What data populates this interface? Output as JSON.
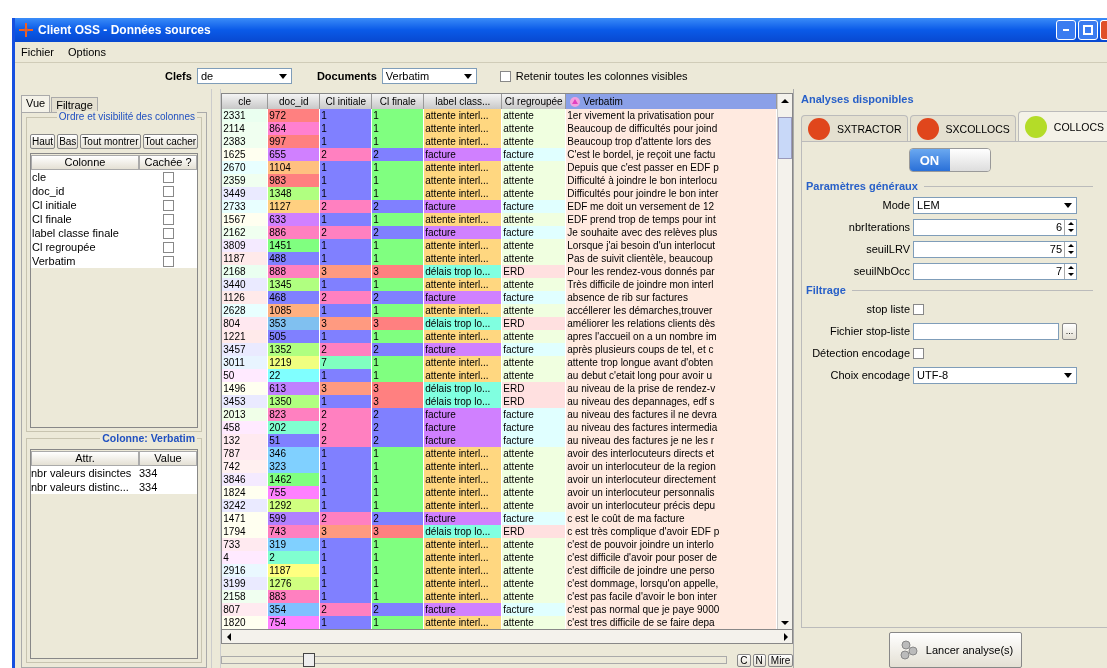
{
  "window": {
    "title": "Client OSS - Données sources"
  },
  "menu": [
    "Fichier",
    "Options"
  ],
  "toolbar": {
    "keys_label": "Clefs",
    "keys_value": "de",
    "documents_label": "Documents",
    "documents_value": "Verbatim",
    "retain": {
      "label": "Retenir toutes les colonnes visibles",
      "checked": false
    }
  },
  "left_tabs": [
    {
      "label": "Vue",
      "selected": true
    },
    {
      "label": "Filtrage",
      "selected": false
    }
  ],
  "columns_panel": {
    "title": "Ordre et visibilité des colonnes",
    "buttons": [
      "Haut",
      "Bas",
      "Tout montrer",
      "Tout cacher"
    ],
    "headers": [
      "Colonne",
      "Cachée ?"
    ],
    "rows": [
      {
        "name": "cle",
        "hidden": false
      },
      {
        "name": "doc_id",
        "hidden": false
      },
      {
        "name": "Cl initiale",
        "hidden": false
      },
      {
        "name": "Cl finale",
        "hidden": false
      },
      {
        "name": "label classe finale",
        "hidden": false
      },
      {
        "name": "Cl regroupée",
        "hidden": false
      },
      {
        "name": "Verbatim",
        "hidden": false
      }
    ]
  },
  "attr_panel": {
    "title": "Colonne: Verbatim",
    "headers": [
      "Attr.",
      "Value"
    ],
    "rows": [
      [
        "nbr valeurs disinctes",
        "334"
      ],
      [
        "nbr valeurs distinc...",
        "334"
      ]
    ]
  },
  "table": {
    "columns": [
      {
        "label": "cle",
        "selected": false
      },
      {
        "label": "doc_id",
        "selected": false
      },
      {
        "label": "Cl initiale",
        "selected": false
      },
      {
        "label": "Cl finale",
        "selected": false
      },
      {
        "label": "label class...",
        "selected": false
      },
      {
        "label": "Cl regroupée",
        "selected": false
      },
      {
        "label": "Verbatim",
        "selected": true
      }
    ],
    "rows": [
      {
        "cells": [
          {
            "text": "2331",
            "color": "#eafff0"
          },
          {
            "text": "972",
            "color": "#ff8080"
          },
          {
            "text": "1",
            "color": "#8080ff"
          },
          {
            "text": "1",
            "color": "#80ff80"
          },
          {
            "text": "attente interl...",
            "color": "#ffd780"
          },
          {
            "text": "attente",
            "color": "#f0ffe0"
          },
          {
            "text": "1er vivement la privatisation pour",
            "color": "#ffeae0"
          }
        ]
      },
      {
        "cells": [
          {
            "text": "2114",
            "color": "#f0fff0"
          },
          {
            "text": "864",
            "color": "#ff80d0"
          },
          {
            "text": "1",
            "color": "#8080ff"
          },
          {
            "text": "1",
            "color": "#80ff80"
          },
          {
            "text": "attente interl...",
            "color": "#ffd780"
          },
          {
            "text": "attente",
            "color": "#f0ffe0"
          },
          {
            "text": "Beaucoup de difficultés pour joind",
            "color": "#ffeae0"
          }
        ]
      },
      {
        "cells": [
          {
            "text": "2383",
            "color": "#f0fff0"
          },
          {
            "text": "997",
            "color": "#ff8080"
          },
          {
            "text": "1",
            "color": "#8080ff"
          },
          {
            "text": "1",
            "color": "#80ff80"
          },
          {
            "text": "attente interl...",
            "color": "#ffd780"
          },
          {
            "text": "attente",
            "color": "#f0ffe0"
          },
          {
            "text": "Beaucoup trop d'attente lors des",
            "color": "#ffeae0"
          }
        ]
      },
      {
        "cells": [
          {
            "text": "1625",
            "color": "#fffff0"
          },
          {
            "text": "655",
            "color": "#d080ff"
          },
          {
            "text": "2",
            "color": "#ff80c0"
          },
          {
            "text": "2",
            "color": "#8080ff"
          },
          {
            "text": "facture",
            "color": "#d080ff"
          },
          {
            "text": "facture",
            "color": "#e0ffff"
          },
          {
            "text": "C'est le bordel, je reçoit une factu",
            "color": "#ffeae0"
          }
        ]
      },
      {
        "cells": [
          {
            "text": "2670",
            "color": "#e8ffff"
          },
          {
            "text": "1104",
            "color": "#ffc080"
          },
          {
            "text": "1",
            "color": "#8080ff"
          },
          {
            "text": "1",
            "color": "#80ff80"
          },
          {
            "text": "attente interl...",
            "color": "#ffd780"
          },
          {
            "text": "attente",
            "color": "#f0ffe0"
          },
          {
            "text": "Depuis que c'est passer en EDF p",
            "color": "#ffeae0"
          }
        ]
      },
      {
        "cells": [
          {
            "text": "2359",
            "color": "#f0fff0"
          },
          {
            "text": "983",
            "color": "#ff8080"
          },
          {
            "text": "1",
            "color": "#8080ff"
          },
          {
            "text": "1",
            "color": "#80ff80"
          },
          {
            "text": "attente interl...",
            "color": "#ffd780"
          },
          {
            "text": "attente",
            "color": "#f0ffe0"
          },
          {
            "text": "Difficulté à joindre le bon interlocu",
            "color": "#ffeae0"
          }
        ]
      },
      {
        "cells": [
          {
            "text": "3449",
            "color": "#eaeaff"
          },
          {
            "text": "1348",
            "color": "#b0ff80"
          },
          {
            "text": "1",
            "color": "#8080ff"
          },
          {
            "text": "1",
            "color": "#80ff80"
          },
          {
            "text": "attente interl...",
            "color": "#ffd780"
          },
          {
            "text": "attente",
            "color": "#f0ffe0"
          },
          {
            "text": "Difficultés pour joindre le bon inter",
            "color": "#ffeae0"
          }
        ]
      },
      {
        "cells": [
          {
            "text": "2733",
            "color": "#e8ffff"
          },
          {
            "text": "1127",
            "color": "#ffd080"
          },
          {
            "text": "2",
            "color": "#ff80c0"
          },
          {
            "text": "2",
            "color": "#8080ff"
          },
          {
            "text": "facture",
            "color": "#d080ff"
          },
          {
            "text": "facture",
            "color": "#e0ffff"
          },
          {
            "text": "EDF me doit un versement de 12",
            "color": "#ffeae0"
          }
        ]
      },
      {
        "cells": [
          {
            "text": "1567",
            "color": "#fffff0"
          },
          {
            "text": "633",
            "color": "#d080ff"
          },
          {
            "text": "1",
            "color": "#8080ff"
          },
          {
            "text": "1",
            "color": "#80ff80"
          },
          {
            "text": "attente interl...",
            "color": "#ffd780"
          },
          {
            "text": "attente",
            "color": "#f0ffe0"
          },
          {
            "text": "EDF prend trop de temps pour int",
            "color": "#ffeae0"
          }
        ]
      },
      {
        "cells": [
          {
            "text": "2162",
            "color": "#f0fff0"
          },
          {
            "text": "886",
            "color": "#ff80c0"
          },
          {
            "text": "2",
            "color": "#ff80c0"
          },
          {
            "text": "2",
            "color": "#8080ff"
          },
          {
            "text": "facture",
            "color": "#d080ff"
          },
          {
            "text": "facture",
            "color": "#e0ffff"
          },
          {
            "text": "Je souhaite avec des relèves plus",
            "color": "#ffeae0"
          }
        ]
      },
      {
        "cells": [
          {
            "text": "3809",
            "color": "#f4eaff"
          },
          {
            "text": "1451",
            "color": "#80ff80"
          },
          {
            "text": "1",
            "color": "#8080ff"
          },
          {
            "text": "1",
            "color": "#80ff80"
          },
          {
            "text": "attente interl...",
            "color": "#ffd780"
          },
          {
            "text": "attente",
            "color": "#f0ffe0"
          },
          {
            "text": "Lorsque j'ai besoin d'un interlocut",
            "color": "#ffeae0"
          }
        ]
      },
      {
        "cells": [
          {
            "text": "1187",
            "color": "#ffeaea"
          },
          {
            "text": "488",
            "color": "#8080ff"
          },
          {
            "text": "1",
            "color": "#8080ff"
          },
          {
            "text": "1",
            "color": "#80ff80"
          },
          {
            "text": "attente interl...",
            "color": "#ffd780"
          },
          {
            "text": "attente",
            "color": "#f0ffe0"
          },
          {
            "text": "Pas de suivit clientèle, beaucoup",
            "color": "#ffeae0"
          }
        ]
      },
      {
        "cells": [
          {
            "text": "2168",
            "color": "#eafff0"
          },
          {
            "text": "888",
            "color": "#ff80c0"
          },
          {
            "text": "3",
            "color": "#ff9a80"
          },
          {
            "text": "3",
            "color": "#ff8080"
          },
          {
            "text": "délais trop lo...",
            "color": "#80ffe0"
          },
          {
            "text": "ERD",
            "color": "#ffe0e0"
          },
          {
            "text": "Pour les rendez-vous donnés par",
            "color": "#ffeae0"
          }
        ]
      },
      {
        "cells": [
          {
            "text": "3440",
            "color": "#eaeaff"
          },
          {
            "text": "1345",
            "color": "#b0ff80"
          },
          {
            "text": "1",
            "color": "#8080ff"
          },
          {
            "text": "1",
            "color": "#80ff80"
          },
          {
            "text": "attente interl...",
            "color": "#ffd780"
          },
          {
            "text": "attente",
            "color": "#f0ffe0"
          },
          {
            "text": "Très difficile de joindre mon interl",
            "color": "#ffeae0"
          }
        ]
      },
      {
        "cells": [
          {
            "text": "1126",
            "color": "#ffeaea"
          },
          {
            "text": "468",
            "color": "#8080ff"
          },
          {
            "text": "2",
            "color": "#ff80c0"
          },
          {
            "text": "2",
            "color": "#8080ff"
          },
          {
            "text": "facture",
            "color": "#d080ff"
          },
          {
            "text": "facture",
            "color": "#e0ffff"
          },
          {
            "text": "absence de rib sur factures",
            "color": "#ffeae0"
          }
        ]
      },
      {
        "cells": [
          {
            "text": "2628",
            "color": "#e8ffff"
          },
          {
            "text": "1085",
            "color": "#ffb080"
          },
          {
            "text": "1",
            "color": "#8080ff"
          },
          {
            "text": "1",
            "color": "#80ff80"
          },
          {
            "text": "attente interl...",
            "color": "#ffd780"
          },
          {
            "text": "attente",
            "color": "#f0ffe0"
          },
          {
            "text": "accéllerer les démarches,trouver",
            "color": "#ffeae0"
          }
        ]
      },
      {
        "cells": [
          {
            "text": "804",
            "color": "#ffe8f0"
          },
          {
            "text": "353",
            "color": "#80c0f0"
          },
          {
            "text": "3",
            "color": "#ff9a80"
          },
          {
            "text": "3",
            "color": "#ff8080"
          },
          {
            "text": "délais trop lo...",
            "color": "#80ffe0"
          },
          {
            "text": "ERD",
            "color": "#ffe0e0"
          },
          {
            "text": "améliorer les relations clients dès",
            "color": "#ffeae0"
          }
        ]
      },
      {
        "cells": [
          {
            "text": "1221",
            "color": "#ffeaea"
          },
          {
            "text": "505",
            "color": "#8080ff"
          },
          {
            "text": "1",
            "color": "#8080ff"
          },
          {
            "text": "1",
            "color": "#80ff80"
          },
          {
            "text": "attente interl...",
            "color": "#ffd780"
          },
          {
            "text": "attente",
            "color": "#f0ffe0"
          },
          {
            "text": "apres l'accueil on a un nombre im",
            "color": "#ffeae0"
          }
        ]
      },
      {
        "cells": [
          {
            "text": "3457",
            "color": "#eaeaff"
          },
          {
            "text": "1352",
            "color": "#b0ff80"
          },
          {
            "text": "2",
            "color": "#ff80c0"
          },
          {
            "text": "2",
            "color": "#8080ff"
          },
          {
            "text": "facture",
            "color": "#d080ff"
          },
          {
            "text": "facture",
            "color": "#e0ffff"
          },
          {
            "text": "après plusieurs coups de tel, et c",
            "color": "#ffeae0"
          }
        ]
      },
      {
        "cells": [
          {
            "text": "3011",
            "color": "#e8f4ff"
          },
          {
            "text": "1219",
            "color": "#f0ff80"
          },
          {
            "text": "7",
            "color": "#80ffc0"
          },
          {
            "text": "1",
            "color": "#80ff80"
          },
          {
            "text": "attente interl...",
            "color": "#ffd780"
          },
          {
            "text": "attente",
            "color": "#f0ffe0"
          },
          {
            "text": "attente trop longue avant d'obten",
            "color": "#ffeae0"
          }
        ]
      },
      {
        "cells": [
          {
            "text": "50",
            "color": "#ffeaff"
          },
          {
            "text": "22",
            "color": "#80ffff"
          },
          {
            "text": "1",
            "color": "#8080ff"
          },
          {
            "text": "1",
            "color": "#80ff80"
          },
          {
            "text": "attente interl...",
            "color": "#ffd780"
          },
          {
            "text": "attente",
            "color": "#f0ffe0"
          },
          {
            "text": "au debut c'etait long pour avoir u",
            "color": "#ffeae0"
          }
        ]
      },
      {
        "cells": [
          {
            "text": "1496",
            "color": "#fffff0"
          },
          {
            "text": "613",
            "color": "#c080ff"
          },
          {
            "text": "3",
            "color": "#ff9a80"
          },
          {
            "text": "3",
            "color": "#ff8080"
          },
          {
            "text": "délais trop lo...",
            "color": "#80ffe0"
          },
          {
            "text": "ERD",
            "color": "#ffe0e0"
          },
          {
            "text": "au niveau de la prise de rendez-v",
            "color": "#ffeae0"
          }
        ]
      },
      {
        "cells": [
          {
            "text": "3453",
            "color": "#eaeaff"
          },
          {
            "text": "1350",
            "color": "#b0ff80"
          },
          {
            "text": "1",
            "color": "#8080ff"
          },
          {
            "text": "3",
            "color": "#ff8080"
          },
          {
            "text": "délais trop lo...",
            "color": "#80ffe0"
          },
          {
            "text": "ERD",
            "color": "#ffe0e0"
          },
          {
            "text": "au niveau des depannages, edf s",
            "color": "#ffeae0"
          }
        ]
      },
      {
        "cells": [
          {
            "text": "2013",
            "color": "#f0ffe8"
          },
          {
            "text": "823",
            "color": "#ff80c0"
          },
          {
            "text": "2",
            "color": "#ff80c0"
          },
          {
            "text": "2",
            "color": "#8080ff"
          },
          {
            "text": "facture",
            "color": "#d080ff"
          },
          {
            "text": "facture",
            "color": "#e0ffff"
          },
          {
            "text": "au niveau des factures il ne devra",
            "color": "#ffeae0"
          }
        ]
      },
      {
        "cells": [
          {
            "text": "458",
            "color": "#ffeaff"
          },
          {
            "text": "202",
            "color": "#80ffd0"
          },
          {
            "text": "2",
            "color": "#ff80c0"
          },
          {
            "text": "2",
            "color": "#8080ff"
          },
          {
            "text": "facture",
            "color": "#d080ff"
          },
          {
            "text": "facture",
            "color": "#e0ffff"
          },
          {
            "text": "au niveau des factures intermedia",
            "color": "#ffeae0"
          }
        ]
      },
      {
        "cells": [
          {
            "text": "132",
            "color": "#ffeaf0"
          },
          {
            "text": "51",
            "color": "#8080ff"
          },
          {
            "text": "2",
            "color": "#ff80c0"
          },
          {
            "text": "2",
            "color": "#8080ff"
          },
          {
            "text": "facture",
            "color": "#d080ff"
          },
          {
            "text": "facture",
            "color": "#e0ffff"
          },
          {
            "text": "au niveau des factures je ne les r",
            "color": "#ffeae0"
          }
        ]
      },
      {
        "cells": [
          {
            "text": "787",
            "color": "#ffeaf0"
          },
          {
            "text": "346",
            "color": "#80d0ff"
          },
          {
            "text": "1",
            "color": "#8080ff"
          },
          {
            "text": "1",
            "color": "#80ff80"
          },
          {
            "text": "attente interl...",
            "color": "#ffd780"
          },
          {
            "text": "attente",
            "color": "#f0ffe0"
          },
          {
            "text": "avoir des interlocuteurs directs et",
            "color": "#ffeae0"
          }
        ]
      },
      {
        "cells": [
          {
            "text": "742",
            "color": "#fff0f0"
          },
          {
            "text": "323",
            "color": "#80d0ff"
          },
          {
            "text": "1",
            "color": "#8080ff"
          },
          {
            "text": "1",
            "color": "#80ff80"
          },
          {
            "text": "attente interl...",
            "color": "#ffd780"
          },
          {
            "text": "attente",
            "color": "#f0ffe0"
          },
          {
            "text": "avoir un interlocuteur de la region",
            "color": "#ffeae0"
          }
        ]
      },
      {
        "cells": [
          {
            "text": "3846",
            "color": "#f4eaff"
          },
          {
            "text": "1462",
            "color": "#80ff80"
          },
          {
            "text": "1",
            "color": "#8080ff"
          },
          {
            "text": "1",
            "color": "#80ff80"
          },
          {
            "text": "attente interl...",
            "color": "#ffd780"
          },
          {
            "text": "attente",
            "color": "#f0ffe0"
          },
          {
            "text": "avoir un interlocuteur directement",
            "color": "#ffeae0"
          }
        ]
      },
      {
        "cells": [
          {
            "text": "1824",
            "color": "#fffff0"
          },
          {
            "text": "755",
            "color": "#ff80ff"
          },
          {
            "text": "1",
            "color": "#8080ff"
          },
          {
            "text": "1",
            "color": "#80ff80"
          },
          {
            "text": "attente interl...",
            "color": "#ffd780"
          },
          {
            "text": "attente",
            "color": "#f0ffe0"
          },
          {
            "text": "avoir un interlocuteur personnalis",
            "color": "#ffeae0"
          }
        ]
      },
      {
        "cells": [
          {
            "text": "3242",
            "color": "#eaeaff"
          },
          {
            "text": "1292",
            "color": "#d0ff80"
          },
          {
            "text": "1",
            "color": "#8080ff"
          },
          {
            "text": "1",
            "color": "#80ff80"
          },
          {
            "text": "attente interl...",
            "color": "#ffd780"
          },
          {
            "text": "attente",
            "color": "#f0ffe0"
          },
          {
            "text": "avoir un interlocuteur précis depu",
            "color": "#ffeae0"
          }
        ]
      },
      {
        "cells": [
          {
            "text": "1471",
            "color": "#fffff0"
          },
          {
            "text": "599",
            "color": "#b080ff"
          },
          {
            "text": "2",
            "color": "#ff80c0"
          },
          {
            "text": "2",
            "color": "#8080ff"
          },
          {
            "text": "facture",
            "color": "#d080ff"
          },
          {
            "text": "facture",
            "color": "#e0ffff"
          },
          {
            "text": "c est le coût de ma facture",
            "color": "#ffeae0"
          }
        ]
      },
      {
        "cells": [
          {
            "text": "1794",
            "color": "#fffff0"
          },
          {
            "text": "743",
            "color": "#ff80c0"
          },
          {
            "text": "3",
            "color": "#ff9a80"
          },
          {
            "text": "3",
            "color": "#ff8080"
          },
          {
            "text": "délais trop lo...",
            "color": "#80ffe0"
          },
          {
            "text": "ERD",
            "color": "#ffe0e0"
          },
          {
            "text": "c est très complique d'avoir EDF p",
            "color": "#ffeae0"
          }
        ]
      },
      {
        "cells": [
          {
            "text": "733",
            "color": "#ffeaf0"
          },
          {
            "text": "319",
            "color": "#80d0ff"
          },
          {
            "text": "1",
            "color": "#8080ff"
          },
          {
            "text": "1",
            "color": "#80ff80"
          },
          {
            "text": "attente interl...",
            "color": "#ffd780"
          },
          {
            "text": "attente",
            "color": "#f0ffe0"
          },
          {
            "text": "c'est de pouvoir joindre un interlo",
            "color": "#ffeae0"
          }
        ]
      },
      {
        "cells": [
          {
            "text": "4",
            "color": "#ffeaff"
          },
          {
            "text": "2",
            "color": "#80ffd0"
          },
          {
            "text": "1",
            "color": "#8080ff"
          },
          {
            "text": "1",
            "color": "#80ff80"
          },
          {
            "text": "attente interl...",
            "color": "#ffd780"
          },
          {
            "text": "attente",
            "color": "#f0ffe0"
          },
          {
            "text": "c'est difficile d'avoir pour poser de",
            "color": "#ffeae0"
          }
        ]
      },
      {
        "cells": [
          {
            "text": "2916",
            "color": "#eaf8ff"
          },
          {
            "text": "1187",
            "color": "#ffff80"
          },
          {
            "text": "1",
            "color": "#8080ff"
          },
          {
            "text": "1",
            "color": "#80ff80"
          },
          {
            "text": "attente interl...",
            "color": "#ffd780"
          },
          {
            "text": "attente",
            "color": "#f0ffe0"
          },
          {
            "text": "c'est difficile de joindre une perso",
            "color": "#ffeae0"
          }
        ]
      },
      {
        "cells": [
          {
            "text": "3199",
            "color": "#eaeaff"
          },
          {
            "text": "1276",
            "color": "#d0ff80"
          },
          {
            "text": "1",
            "color": "#8080ff"
          },
          {
            "text": "1",
            "color": "#80ff80"
          },
          {
            "text": "attente interl...",
            "color": "#ffd780"
          },
          {
            "text": "attente",
            "color": "#f0ffe0"
          },
          {
            "text": "c'est dommage, lorsqu'on appelle,",
            "color": "#ffeae0"
          }
        ]
      },
      {
        "cells": [
          {
            "text": "2158",
            "color": "#f0fff0"
          },
          {
            "text": "883",
            "color": "#ff80c0"
          },
          {
            "text": "1",
            "color": "#8080ff"
          },
          {
            "text": "1",
            "color": "#80ff80"
          },
          {
            "text": "attente interl...",
            "color": "#ffd780"
          },
          {
            "text": "attente",
            "color": "#f0ffe0"
          },
          {
            "text": "c'est pas facile d'avoir le bon inter",
            "color": "#ffeae0"
          }
        ]
      },
      {
        "cells": [
          {
            "text": "807",
            "color": "#ffeaf0"
          },
          {
            "text": "354",
            "color": "#80c0ff"
          },
          {
            "text": "2",
            "color": "#ff80c0"
          },
          {
            "text": "2",
            "color": "#8080ff"
          },
          {
            "text": "facture",
            "color": "#d080ff"
          },
          {
            "text": "facture",
            "color": "#e0ffff"
          },
          {
            "text": "c'est pas normal que je paye 9000",
            "color": "#ffeae0"
          }
        ]
      },
      {
        "cells": [
          {
            "text": "1820",
            "color": "#fffff0"
          },
          {
            "text": "754",
            "color": "#ff80ff"
          },
          {
            "text": "1",
            "color": "#8080ff"
          },
          {
            "text": "1",
            "color": "#80ff80"
          },
          {
            "text": "attente interl...",
            "color": "#ffd780"
          },
          {
            "text": "attente",
            "color": "#f0ffe0"
          },
          {
            "text": "c'est tres difficile de se faire depa",
            "color": "#ffeae0"
          }
        ]
      }
    ]
  },
  "bottom_slider": {
    "level": 0.16
  },
  "bottom_buttons": [
    "C",
    "N",
    "Mire"
  ],
  "analyses": {
    "title": "Analyses disponibles",
    "tabs": [
      {
        "label": "SXTRACTOR",
        "color": "#e0461c",
        "selected": false
      },
      {
        "label": "SXCOLLOCS",
        "color": "#e0461c",
        "selected": false
      },
      {
        "label": "COLLOCS",
        "color": "#b4dc28",
        "selected": true
      }
    ],
    "switch": {
      "label": "ON",
      "on": true
    },
    "general": {
      "title": "Paramètres généraux",
      "mode": {
        "label": "Mode",
        "value": "LEM"
      },
      "spinners": [
        {
          "label": "nbrIterations",
          "value": "6"
        },
        {
          "label": "seuilLRV",
          "value": "75"
        },
        {
          "label": "seuilNbOcc",
          "value": "7"
        }
      ]
    },
    "filter": {
      "title": "Filtrage",
      "stop_list": {
        "label": "stop liste",
        "checked": false
      },
      "stop_file": {
        "label": "Fichier stop-liste",
        "button": "..."
      },
      "detection": {
        "label": "Détection encodage",
        "checked": false
      },
      "encoding": {
        "label": "Choix encodage",
        "value": "UTF-8"
      }
    },
    "run_button": "Lancer analyse(s)"
  }
}
